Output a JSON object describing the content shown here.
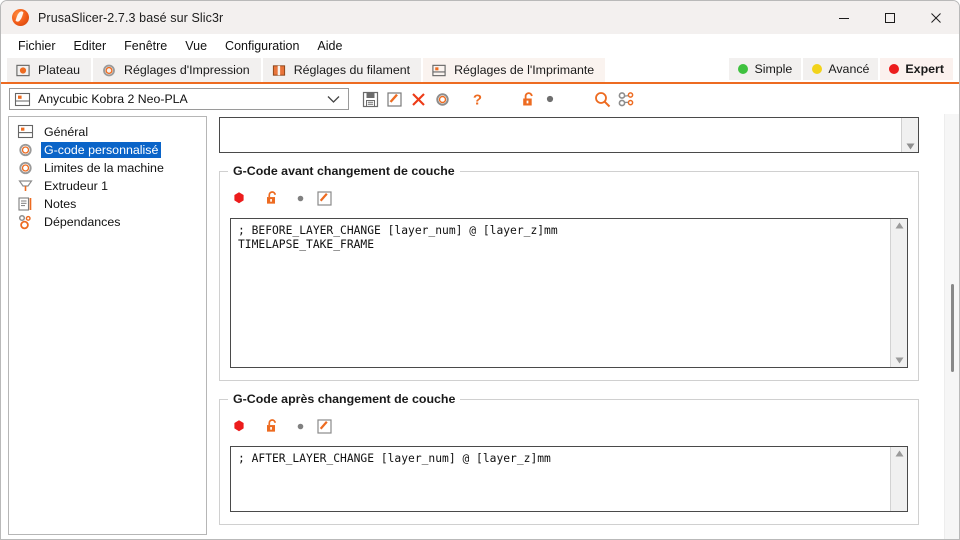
{
  "window": {
    "title": "PrusaSlicer-2.7.3 basé sur Slic3r",
    "app_icon": "prusaslicer-logo-icon",
    "controls": {
      "minimize": "minimize-icon",
      "maximize": "maximize-icon",
      "close": "close-icon"
    }
  },
  "menu": {
    "items": [
      {
        "label": "Fichier"
      },
      {
        "label": "Editer"
      },
      {
        "label": "Fenêtre"
      },
      {
        "label": "Vue"
      },
      {
        "label": "Configuration"
      },
      {
        "label": "Aide"
      }
    ]
  },
  "tabs": {
    "items": [
      {
        "label": "Plateau",
        "icon": "plater-icon",
        "active": false
      },
      {
        "label": "Réglages d'Impression",
        "icon": "print-settings-icon",
        "active": false
      },
      {
        "label": "Réglages du filament",
        "icon": "filament-settings-icon",
        "active": false
      },
      {
        "label": "Réglages de l'Imprimante",
        "icon": "printer-settings-icon",
        "active": true
      }
    ]
  },
  "modes": {
    "items": [
      {
        "label": "Simple",
        "color": "#3fc13f",
        "current": false
      },
      {
        "label": "Avancé",
        "color": "#f2d31b",
        "current": false
      },
      {
        "label": "Expert",
        "color": "#ec1c1c",
        "current": true
      }
    ]
  },
  "preset": {
    "icon": "printer-preset-icon",
    "value": "Anycubic Kobra 2 Neo-PLA",
    "chevron": "chevron-down-icon",
    "toolbar": [
      {
        "name": "save-preset-icon",
        "title": "Enregistrer"
      },
      {
        "name": "rename-preset-icon",
        "title": "Renommer"
      },
      {
        "name": "delete-preset-icon",
        "title": "Supprimer"
      },
      {
        "name": "cog-preset-icon",
        "title": "Options"
      },
      {
        "name": "question-help-icon",
        "title": "Aide"
      },
      {
        "name": "unlock-icon",
        "title": "Déverrouiller"
      },
      {
        "name": "modified-dot-icon",
        "title": "Modifié"
      },
      {
        "name": "search-icon",
        "title": "Rechercher"
      },
      {
        "name": "compare-presets-icon",
        "title": "Comparer"
      }
    ]
  },
  "sidebar": {
    "items": [
      {
        "label": "Général",
        "icon": "general-icon",
        "selected": false
      },
      {
        "label": "G-code personnalisé",
        "icon": "custom-gcode-icon",
        "selected": true
      },
      {
        "label": "Limites de la machine",
        "icon": "machine-limits-icon",
        "selected": false
      },
      {
        "label": "Extrudeur 1",
        "icon": "extruder-icon",
        "selected": false
      },
      {
        "label": "Notes",
        "icon": "notes-icon",
        "selected": false
      },
      {
        "label": "Dépendances",
        "icon": "dependencies-icon",
        "selected": false
      }
    ]
  },
  "main": {
    "top_partial_box": {
      "name": "previous-gcode-textarea",
      "value": ""
    },
    "sections": [
      {
        "title": "G-Code avant changement de couche",
        "icons": [
          {
            "name": "expert-mode-dot-icon",
            "color": "#ec1c1c"
          },
          {
            "name": "unlock-icon",
            "color": "#ed6b21"
          },
          {
            "name": "system-value-dot-icon",
            "color": "#808080"
          },
          {
            "name": "edit-pencil-icon",
            "color": "#ed6b21"
          }
        ],
        "textarea": {
          "name": "before-layer-change-gcode-textarea",
          "value": "; BEFORE_LAYER_CHANGE [layer_num] @ [layer_z]mm\nTIMELAPSE_TAKE_FRAME"
        }
      },
      {
        "title": "G-Code après changement de couche",
        "icons": [
          {
            "name": "expert-mode-dot-icon",
            "color": "#ec1c1c"
          },
          {
            "name": "unlock-icon",
            "color": "#ed6b21"
          },
          {
            "name": "system-value-dot-icon",
            "color": "#808080"
          },
          {
            "name": "edit-pencil-icon",
            "color": "#ed6b21"
          }
        ],
        "textarea": {
          "name": "after-layer-change-gcode-textarea",
          "value": "; AFTER_LAYER_CHANGE [layer_num] @ [layer_z]mm"
        }
      }
    ]
  },
  "colors": {
    "accent": "#ed6b21",
    "selection": "#0a64c8",
    "expert_red": "#ec1c1c"
  }
}
